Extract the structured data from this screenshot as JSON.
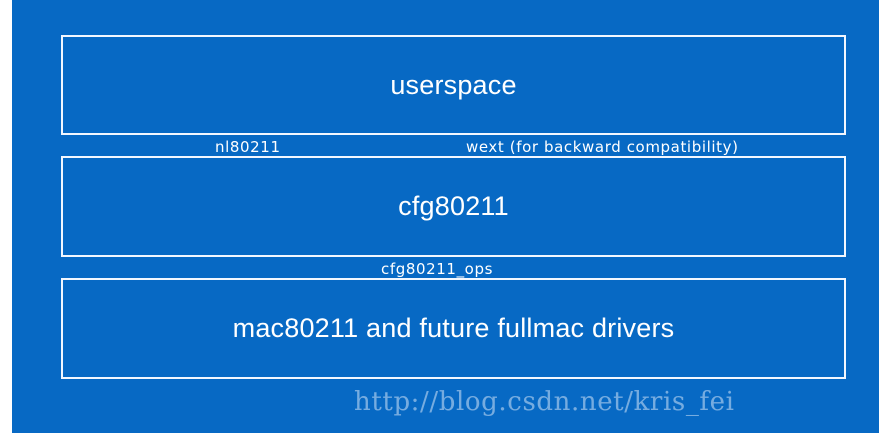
{
  "diagram": {
    "layers": [
      {
        "label": "userspace"
      },
      {
        "label": "cfg80211"
      },
      {
        "label": "mac80211 and future fullmac drivers"
      }
    ],
    "interfaces": {
      "nl80211": "nl80211",
      "wext": "wext (for backward compatibility)",
      "cfg80211_ops": "cfg80211_ops"
    },
    "colors": {
      "background": "#0769c4",
      "border": "#f2f7ff",
      "text": "#ffffff"
    }
  },
  "watermark": {
    "text": "http://blog.csdn.net/kris_fei"
  }
}
